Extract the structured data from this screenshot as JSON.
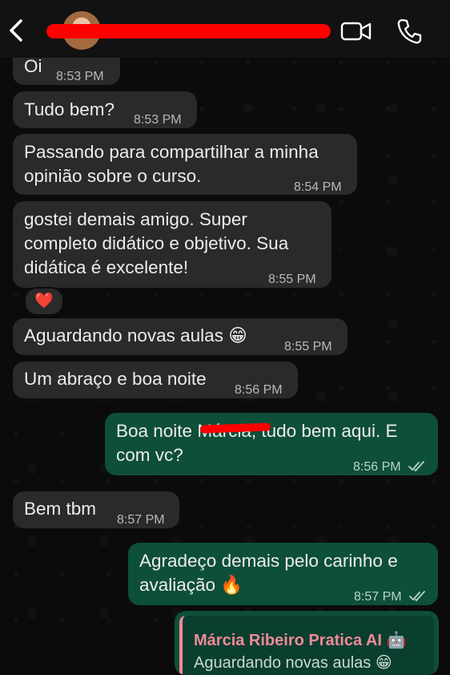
{
  "header": {
    "back_icon": "chevron-left-icon",
    "video_icon": "video-camera-icon",
    "phone_icon": "phone-icon"
  },
  "messages": [
    {
      "text": "Oi",
      "time": "8:53 PM"
    },
    {
      "text": "Tudo bem?",
      "time": "8:53 PM"
    },
    {
      "text": "Passando para compartilhar a minha\nopinião sobre o curso.",
      "time": "8:54 PM"
    },
    {
      "text": "gostei demais amigo. Super\ncompleto didático e objetivo. Sua\ndidática é excelente!",
      "time": "8:55 PM",
      "reaction": "❤️"
    },
    {
      "text": "Aguardando novas aulas 😁",
      "time": "8:55 PM"
    },
    {
      "text": "Um abraço e boa noite",
      "time": "8:56 PM"
    },
    {
      "text": "Boa noite Márcia, tudo bem aqui. E\ncom vc?",
      "time": "8:56 PM"
    },
    {
      "text": "Bem tbm",
      "time": "8:57 PM"
    },
    {
      "text": "Agradeço demais pelo carinho e\navaliação 🔥",
      "time": "8:57 PM"
    }
  ],
  "reply": {
    "name": "Márcia Ribeiro Pratica AI 🤖",
    "text": "Aguardando novas aulas 😁"
  },
  "colors": {
    "background": "#0b0b0b",
    "incoming_bubble": "#2a2a2a",
    "outgoing_bubble": "#0e4f3a",
    "redaction": "#ff0000"
  }
}
